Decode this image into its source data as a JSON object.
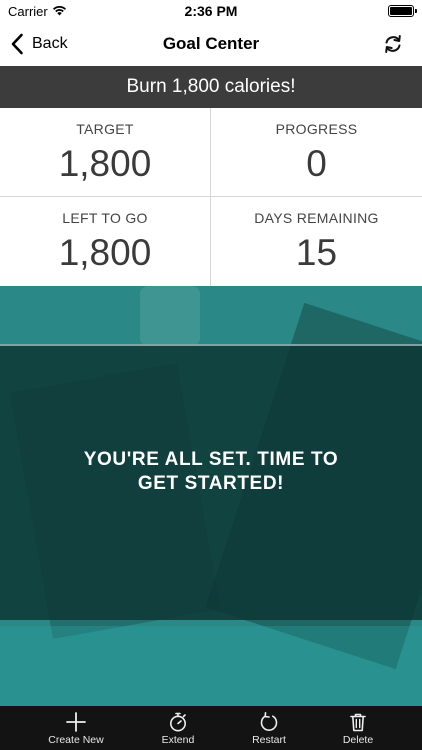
{
  "status_bar": {
    "carrier": "Carrier",
    "time": "2:36 PM"
  },
  "nav": {
    "back_label": "Back",
    "title": "Goal Center"
  },
  "goal": {
    "banner_text": "Burn 1,800 calories!"
  },
  "stats": {
    "target": {
      "label": "TARGET",
      "value": "1,800"
    },
    "progress": {
      "label": "PROGRESS",
      "value": "0"
    },
    "left_to_go": {
      "label": "LEFT TO GO",
      "value": "1,800"
    },
    "days_remaining": {
      "label": "DAYS REMAINING",
      "value": "15"
    }
  },
  "message": {
    "text": "YOU'RE ALL SET. TIME TO GET STARTED!"
  },
  "tabs": {
    "create_new": "Create New",
    "extend": "Extend",
    "restart": "Restart",
    "delete": "Delete"
  },
  "colors": {
    "banner": "#3c3c3c",
    "teal": "#2a8986",
    "panel": "#0c3432",
    "tab_bar": "#131313"
  },
  "icons": {
    "wifi": "wifi-icon",
    "battery": "battery-icon",
    "back": "chevron-left-icon",
    "refresh": "refresh-icon",
    "create_new": "plus-icon",
    "extend": "stopwatch-icon",
    "restart": "restart-icon",
    "delete": "trash-icon"
  }
}
